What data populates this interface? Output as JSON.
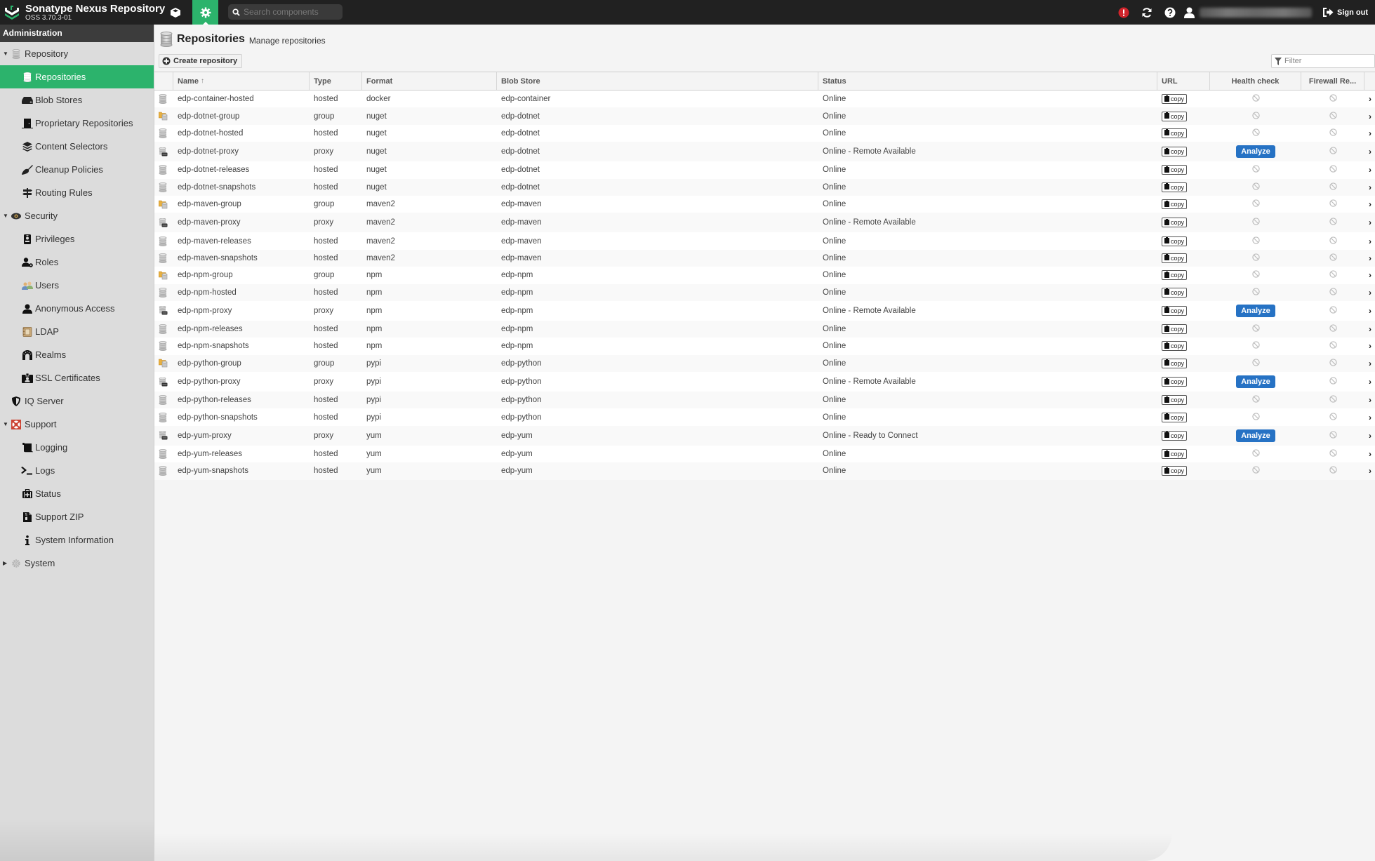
{
  "app": {
    "title": "Sonatype Nexus Repository",
    "version": "OSS 3.70.3-01",
    "brand_color": "#2cb36c"
  },
  "topbar": {
    "browse_icon": "cube-icon",
    "admin_icon": "gear-icon",
    "search_placeholder": "Search components",
    "alert_icon": "exclamation-circle-icon",
    "alert_color": "#d0242b",
    "refresh_icon": "refresh-icon",
    "help_icon": "question-circle-icon",
    "user_icon": "user-icon",
    "sign_out_label": "Sign out"
  },
  "sidebar": {
    "header": "Administration",
    "items": [
      {
        "label": "Repository",
        "level": 0,
        "expanded": true,
        "icon": "database-icon"
      },
      {
        "label": "Repositories",
        "level": 1,
        "active": true,
        "icon": "database-icon"
      },
      {
        "label": "Blob Stores",
        "level": 1,
        "icon": "hdd-icon"
      },
      {
        "label": "Proprietary Repositories",
        "level": 1,
        "icon": "door-icon"
      },
      {
        "label": "Content Selectors",
        "level": 1,
        "icon": "layers-icon"
      },
      {
        "label": "Cleanup Policies",
        "level": 1,
        "icon": "broom-icon"
      },
      {
        "label": "Routing Rules",
        "level": 1,
        "icon": "signpost-icon"
      },
      {
        "label": "Security",
        "level": 0,
        "expanded": true,
        "icon": "eye-icon"
      },
      {
        "label": "Privileges",
        "level": 1,
        "icon": "id-badge-icon"
      },
      {
        "label": "Roles",
        "level": 1,
        "icon": "user-gear-icon"
      },
      {
        "label": "Users",
        "level": 1,
        "icon": "users-icon"
      },
      {
        "label": "Anonymous Access",
        "level": 1,
        "icon": "user-icon"
      },
      {
        "label": "LDAP",
        "level": 1,
        "icon": "address-book-icon"
      },
      {
        "label": "Realms",
        "level": 1,
        "icon": "archway-icon"
      },
      {
        "label": "SSL Certificates",
        "level": 1,
        "icon": "id-card-icon"
      },
      {
        "label": "IQ Server",
        "level": 0,
        "icon": "shield-icon"
      },
      {
        "label": "Support",
        "level": 0,
        "expanded": true,
        "icon": "lifebuoy-icon"
      },
      {
        "label": "Logging",
        "level": 1,
        "icon": "scroll-icon"
      },
      {
        "label": "Logs",
        "level": 1,
        "icon": "terminal-icon"
      },
      {
        "label": "Status",
        "level": 1,
        "icon": "medkit-icon"
      },
      {
        "label": "Support ZIP",
        "level": 1,
        "icon": "file-zipper-icon"
      },
      {
        "label": "System Information",
        "level": 1,
        "icon": "info-icon"
      },
      {
        "label": "System",
        "level": 0,
        "expanded": false,
        "icon": "cog-icon"
      }
    ]
  },
  "page": {
    "title": "Repositories",
    "subtitle": "Manage repositories",
    "create_label": "Create repository",
    "filter_placeholder": "Filter"
  },
  "table": {
    "columns": [
      "Name",
      "Type",
      "Format",
      "Blob Store",
      "Status",
      "URL",
      "Health check",
      "Firewall Re..."
    ],
    "sort_indicator": "↑",
    "copy_label": "copy",
    "analyze_label": "Analyze",
    "rows": [
      {
        "name": "edp-container-hosted",
        "type": "hosted",
        "format": "docker",
        "blob": "edp-container",
        "status": "Online",
        "health": "disabled"
      },
      {
        "name": "edp-dotnet-group",
        "type": "group",
        "format": "nuget",
        "blob": "edp-dotnet",
        "status": "Online",
        "health": "disabled"
      },
      {
        "name": "edp-dotnet-hosted",
        "type": "hosted",
        "format": "nuget",
        "blob": "edp-dotnet",
        "status": "Online",
        "health": "disabled"
      },
      {
        "name": "edp-dotnet-proxy",
        "type": "proxy",
        "format": "nuget",
        "blob": "edp-dotnet",
        "status": "Online - Remote Available",
        "health": "analyze"
      },
      {
        "name": "edp-dotnet-releases",
        "type": "hosted",
        "format": "nuget",
        "blob": "edp-dotnet",
        "status": "Online",
        "health": "disabled"
      },
      {
        "name": "edp-dotnet-snapshots",
        "type": "hosted",
        "format": "nuget",
        "blob": "edp-dotnet",
        "status": "Online",
        "health": "disabled"
      },
      {
        "name": "edp-maven-group",
        "type": "group",
        "format": "maven2",
        "blob": "edp-maven",
        "status": "Online",
        "health": "disabled"
      },
      {
        "name": "edp-maven-proxy",
        "type": "proxy",
        "format": "maven2",
        "blob": "edp-maven",
        "status": "Online - Remote Available",
        "health": "disabled"
      },
      {
        "name": "edp-maven-releases",
        "type": "hosted",
        "format": "maven2",
        "blob": "edp-maven",
        "status": "Online",
        "health": "disabled"
      },
      {
        "name": "edp-maven-snapshots",
        "type": "hosted",
        "format": "maven2",
        "blob": "edp-maven",
        "status": "Online",
        "health": "disabled"
      },
      {
        "name": "edp-npm-group",
        "type": "group",
        "format": "npm",
        "blob": "edp-npm",
        "status": "Online",
        "health": "disabled"
      },
      {
        "name": "edp-npm-hosted",
        "type": "hosted",
        "format": "npm",
        "blob": "edp-npm",
        "status": "Online",
        "health": "disabled"
      },
      {
        "name": "edp-npm-proxy",
        "type": "proxy",
        "format": "npm",
        "blob": "edp-npm",
        "status": "Online - Remote Available",
        "health": "analyze"
      },
      {
        "name": "edp-npm-releases",
        "type": "hosted",
        "format": "npm",
        "blob": "edp-npm",
        "status": "Online",
        "health": "disabled"
      },
      {
        "name": "edp-npm-snapshots",
        "type": "hosted",
        "format": "npm",
        "blob": "edp-npm",
        "status": "Online",
        "health": "disabled"
      },
      {
        "name": "edp-python-group",
        "type": "group",
        "format": "pypi",
        "blob": "edp-python",
        "status": "Online",
        "health": "disabled"
      },
      {
        "name": "edp-python-proxy",
        "type": "proxy",
        "format": "pypi",
        "blob": "edp-python",
        "status": "Online - Remote Available",
        "health": "analyze"
      },
      {
        "name": "edp-python-releases",
        "type": "hosted",
        "format": "pypi",
        "blob": "edp-python",
        "status": "Online",
        "health": "disabled"
      },
      {
        "name": "edp-python-snapshots",
        "type": "hosted",
        "format": "pypi",
        "blob": "edp-python",
        "status": "Online",
        "health": "disabled"
      },
      {
        "name": "edp-yum-proxy",
        "type": "proxy",
        "format": "yum",
        "blob": "edp-yum",
        "status": "Online - Ready to Connect",
        "health": "analyze"
      },
      {
        "name": "edp-yum-releases",
        "type": "hosted",
        "format": "yum",
        "blob": "edp-yum",
        "status": "Online",
        "health": "disabled"
      },
      {
        "name": "edp-yum-snapshots",
        "type": "hosted",
        "format": "yum",
        "blob": "edp-yum",
        "status": "Online",
        "health": "disabled"
      }
    ]
  }
}
